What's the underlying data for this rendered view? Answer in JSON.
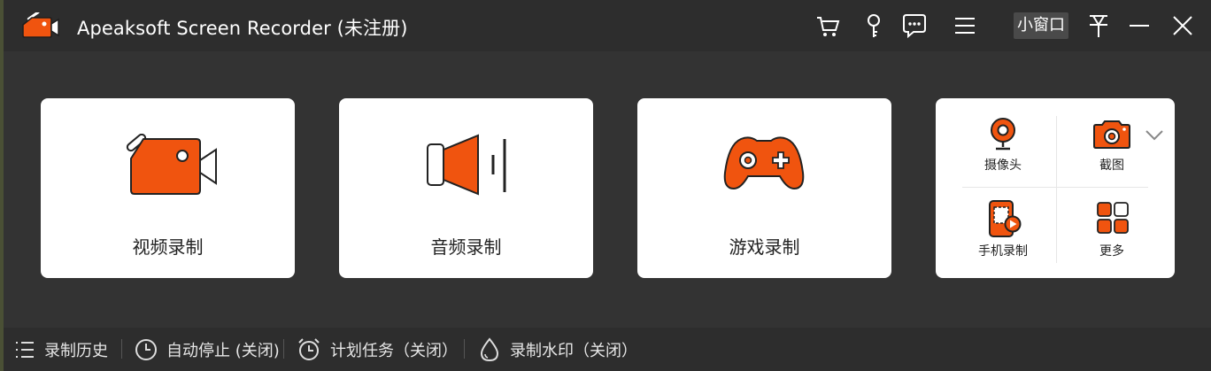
{
  "window": {
    "title": "Apeaksoft Screen Recorder (未注册)",
    "mini_window_label": "小窗口"
  },
  "titlebar_icons": [
    "cart-icon",
    "key-icon",
    "feedback-icon",
    "menu-icon",
    "pin-icon",
    "minimize-icon",
    "close-icon"
  ],
  "cards": [
    {
      "label": "视频录制",
      "icon": "video-camera-icon"
    },
    {
      "label": "音频录制",
      "icon": "speaker-icon"
    },
    {
      "label": "游戏录制",
      "icon": "gamepad-icon"
    }
  ],
  "more_tools": [
    {
      "label": "摄像头",
      "icon": "webcam-icon"
    },
    {
      "label": "截图",
      "icon": "camera-icon"
    },
    {
      "label": "手机录制",
      "icon": "phone-record-icon"
    },
    {
      "label": "更多",
      "icon": "grid-icon"
    }
  ],
  "bottom": {
    "history": "录制历史",
    "auto_stop": "自动停止 (关闭)",
    "schedule": "计划任务（关闭）",
    "watermark": "录制水印（关闭）"
  },
  "colors": {
    "accent": "#f0540f",
    "background": "#333333",
    "card": "#ffffff"
  }
}
